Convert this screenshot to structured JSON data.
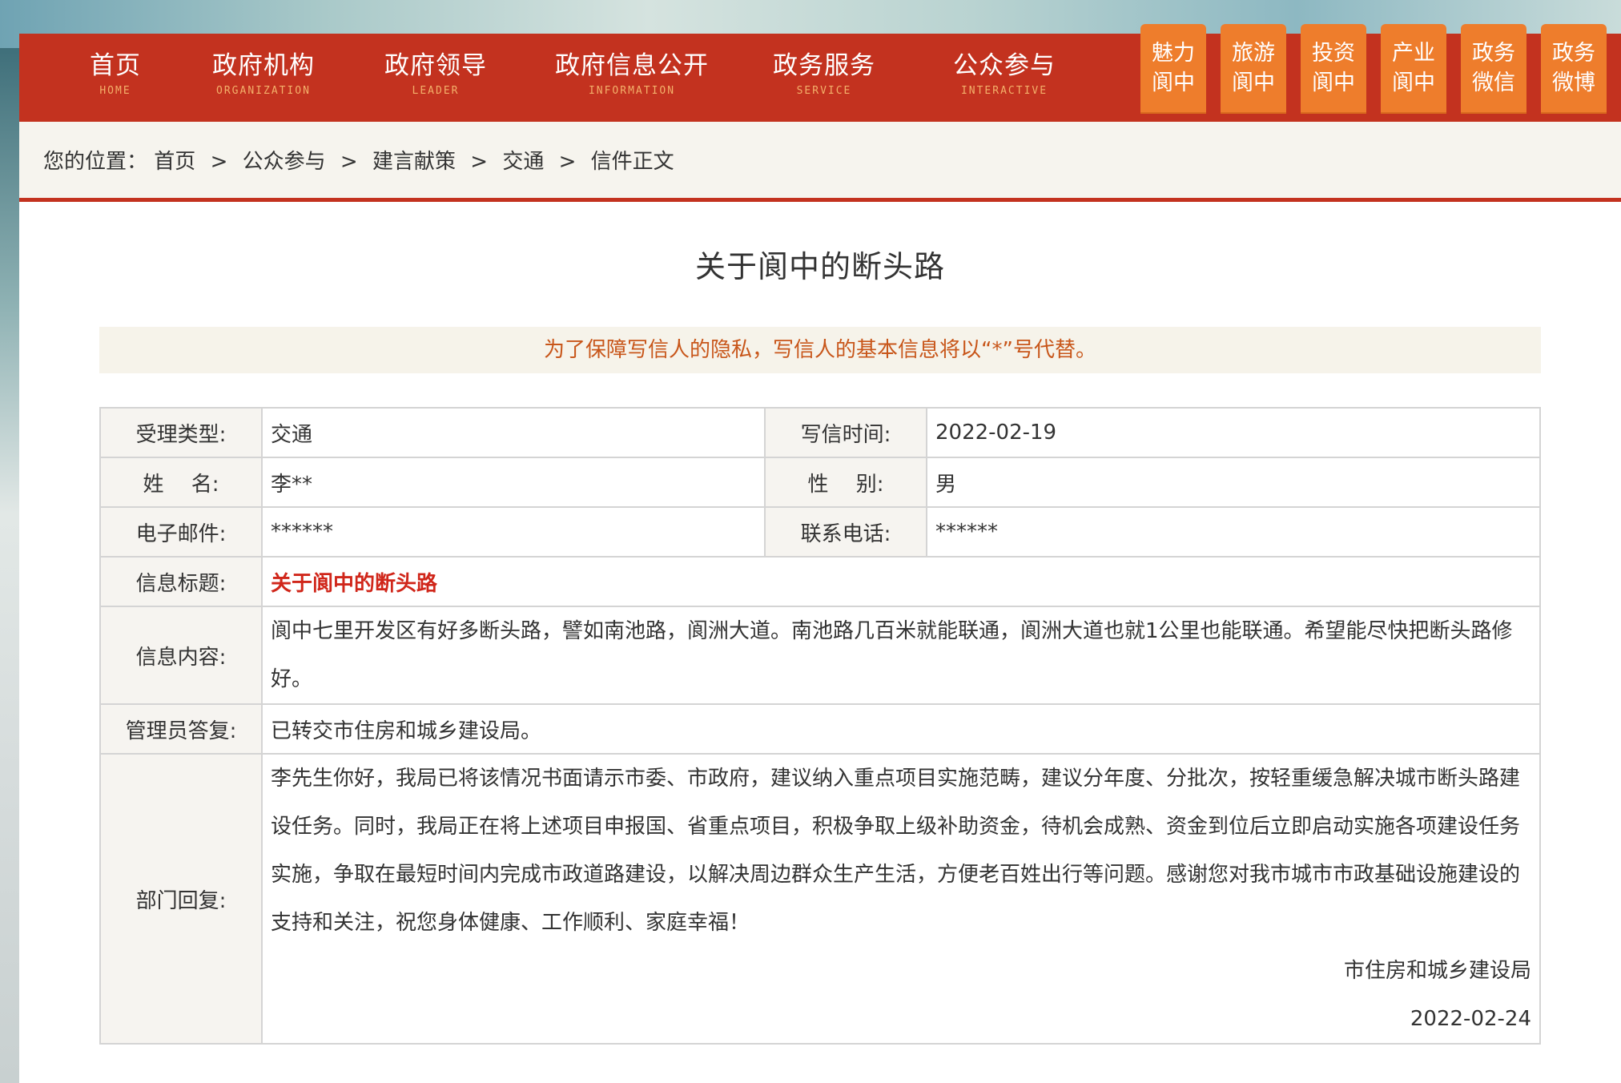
{
  "nav": {
    "items": [
      {
        "cn": "首页",
        "en": "HOME"
      },
      {
        "cn": "政府机构",
        "en": "ORGANIZATION"
      },
      {
        "cn": "政府领导",
        "en": "LEADER"
      },
      {
        "cn": "政府信息公开",
        "en": "INFORMATION"
      },
      {
        "cn": "政务服务",
        "en": "SERVICE"
      },
      {
        "cn": "公众参与",
        "en": "INTERACTIVE"
      }
    ],
    "quick_links": [
      {
        "line1": "魅力",
        "line2": "阆中"
      },
      {
        "line1": "旅游",
        "line2": "阆中"
      },
      {
        "line1": "投资",
        "line2": "阆中"
      },
      {
        "line1": "产业",
        "line2": "阆中"
      },
      {
        "line1": "政务",
        "line2": "微信"
      },
      {
        "line1": "政务",
        "line2": "微博"
      }
    ]
  },
  "breadcrumb": {
    "prefix": "您的位置：",
    "items": [
      "首页",
      "公众参与",
      "建言献策",
      "交通",
      "信件正文"
    ],
    "separator": ">"
  },
  "letter": {
    "title": "关于阆中的断头路",
    "privacy_notice": "为了保障写信人的隐私，写信人的基本信息将以“*”号代替。",
    "labels": {
      "type": "受理类型:",
      "time": "写信时间:",
      "name": "姓　 名:",
      "gender": "性　 别:",
      "email": "电子邮件:",
      "phone": "联系电话:",
      "subject": "信息标题:",
      "content": "信息内容:",
      "admin_reply": "管理员答复:",
      "dept_reply": "部门回复:"
    },
    "values": {
      "type": "交通",
      "time": "2022-02-19",
      "name": "李**",
      "gender": "男",
      "email": "******",
      "phone": "******",
      "subject": "关于阆中的断头路",
      "content": "阆中七里开发区有好多断头路，譬如南池路，阆洲大道。南池路几百米就能联通，阆洲大道也就1公里也能联通。希望能尽快把断头路修好。",
      "admin_reply": "已转交市住房和城乡建设局。",
      "dept_reply": "李先生你好，我局已将该情况书面请示市委、市政府，建议纳入重点项目实施范畴，建议分年度、分批次，按轻重缓急解决城市断头路建设任务。同时，我局正在将上述项目申报国、省重点项目，积极争取上级补助资金，待机会成熟、资金到位后立即启动实施各项建设任务实施，争取在最短时间内完成市政道路建设，以解决周边群众生产生活，方便老百姓出行等问题。感谢您对我市城市市政基础设施建设的支持和关注，祝您身体健康、工作顺利、家庭幸福！",
      "dept_name": "市住房和城乡建设局",
      "dept_date": "2022-02-24"
    }
  },
  "colors": {
    "nav_red": "#c3321f",
    "quick_orange": "#ee7d2c",
    "notice_orange": "#c8561a",
    "subject_red": "#d0261a"
  }
}
